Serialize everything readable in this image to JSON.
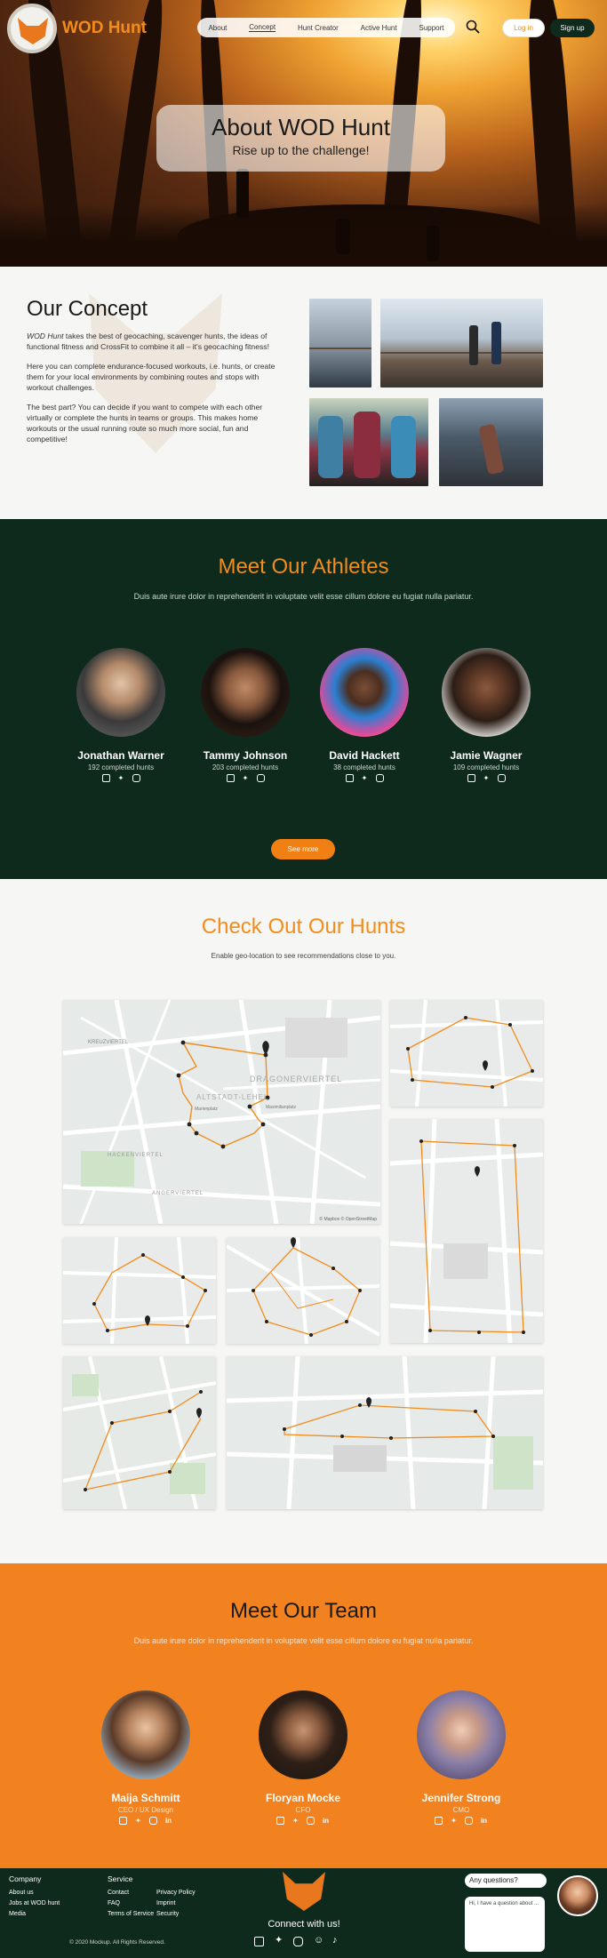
{
  "header": {
    "brand": "WOD Hunt",
    "nav": [
      "About",
      "Concept",
      "Hunt Creator",
      "Active Hunt",
      "Support"
    ],
    "active_nav": "Concept",
    "login": "Log in",
    "signup": "Sign up"
  },
  "hero": {
    "title": "About WOD Hunt",
    "subtitle": "Rise up to the challenge!"
  },
  "concept": {
    "title": "Our Concept",
    "p1_brand": "WOD Hunt",
    "p1_rest": " takes the best of geocaching, scavenger hunts, the ideas of functional fitness and CrossFit to combine it all – it's geocaching fitness!",
    "p2": "Here you can complete endurance-focused workouts, i.e. hunts, or create them for your local environments by combining routes and stops with workout challenges.",
    "p3": "The best part? You can decide if you want to compete with each other virtually or complete the hunts in teams or groups. This makes home workouts or the usual running route so much more social, fun and competitive!"
  },
  "athletes": {
    "title": "Meet Our Athletes",
    "subtitle": "Duis aute irure dolor in reprehenderit in voluptate velit esse cillum dolore eu fugiat nulla pariatur.",
    "items": [
      {
        "name": "Jonathan Warner",
        "count": "192 completed hunts"
      },
      {
        "name": "Tammy Johnson",
        "count": "203 completed hunts"
      },
      {
        "name": "David Hackett",
        "count": "38 completed hunts"
      },
      {
        "name": "Jamie Wagner",
        "count": "109 completed hunts"
      }
    ],
    "button": "See more"
  },
  "hunts": {
    "title": "Check Out Our Hunts",
    "subtitle": "Enable geo-location to see recommendations close to you.",
    "map_labels": [
      "KREUZVIERTEL",
      "DRAGONERVIERTEL",
      "ALTSTADT-LEHEL",
      "HACKENVIERTEL",
      "ANGERVIERTEL",
      "Marienplatz",
      "Maximilianplatz",
      "© Mapbox © OpenStreetMap"
    ]
  },
  "team": {
    "title": "Meet Our Team",
    "subtitle": "Duis aute irure dolor in reprehenderit in voluptate velit esse cillum dolore eu fugiat nulla pariatur.",
    "members": [
      {
        "name": "Maija Schmitt",
        "role": "CEO / UX Design"
      },
      {
        "name": "Floryan Mocke",
        "role": "CFO"
      },
      {
        "name": "Jennifer Strong",
        "role": "CMO"
      }
    ]
  },
  "footer": {
    "company_title": "Company",
    "company_links": [
      "About us",
      "Jobs at WOD hunt",
      "Media"
    ],
    "service_title": "Service",
    "service_col1": [
      "Contact",
      "FAQ",
      "Terms of Service"
    ],
    "service_col2": [
      "Privacy Policy",
      "Imprint",
      "Security"
    ],
    "copyright": "© 2020 Mockup. All Rights Reserved.",
    "connect": "Connect with us!",
    "chat_question": "Any questions?",
    "chat_placeholder": "Hi, I have a question about ..."
  },
  "colors": {
    "accent": "#f28c1c",
    "dark": "#0d2a1c",
    "team_bg": "#f28220"
  }
}
